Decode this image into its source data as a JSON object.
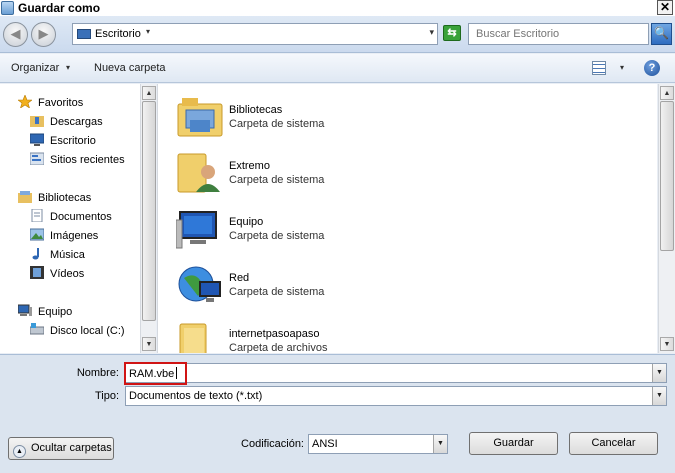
{
  "window": {
    "title": "Guardar como",
    "close_glyph": "✕"
  },
  "nav": {
    "back_glyph": "◀",
    "forward_glyph": "▶",
    "address_crumb": "Escritorio",
    "crumb_arrow": "▾",
    "address_dropdown": "▾",
    "refresh_glyph": "⇆",
    "search_placeholder": "Buscar Escritorio",
    "search_glyph": "🔍"
  },
  "toolbar": {
    "organize_label": "Organizar",
    "organize_arrow": "▾",
    "new_folder_label": "Nueva carpeta",
    "views_arrow": "▾",
    "help_glyph": "?"
  },
  "sidebar": {
    "favorites": {
      "label": "Favoritos",
      "items": [
        "Descargas",
        "Escritorio",
        "Sitios recientes"
      ]
    },
    "libraries": {
      "label": "Bibliotecas",
      "items": [
        "Documentos",
        "Imágenes",
        "Música",
        "Vídeos"
      ]
    },
    "computer": {
      "label": "Equipo",
      "items": [
        "Disco local (C:)"
      ]
    }
  },
  "scroll": {
    "up_glyph": "▲",
    "down_glyph": "▼"
  },
  "files": [
    {
      "name": "Bibliotecas",
      "type": "Carpeta de sistema"
    },
    {
      "name": "Extremo",
      "type": "Carpeta de sistema"
    },
    {
      "name": "Equipo",
      "type": "Carpeta de sistema"
    },
    {
      "name": "Red",
      "type": "Carpeta de sistema"
    },
    {
      "name": "internetpasoapaso",
      "type": "Carpeta de archivos"
    }
  ],
  "save_form": {
    "name_label": "Nombre:",
    "name_value": "RAM.vbe",
    "type_label": "Tipo:",
    "type_value": "Documentos de texto (*.txt)",
    "encoding_label": "Codificación:",
    "encoding_value": "ANSI",
    "dropdown_glyph": "▼"
  },
  "buttons": {
    "hide_folders": "Ocultar carpetas",
    "hide_folders_glyph": "▲",
    "save": "Guardar",
    "cancel": "Cancelar"
  },
  "colors": {
    "highlight": "#d01414",
    "accent": "#2d6cc0"
  }
}
